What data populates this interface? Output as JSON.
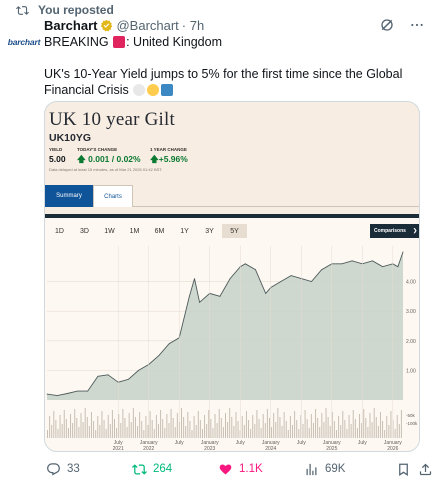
{
  "repost": {
    "label": "You reposted"
  },
  "author": {
    "avatar_text": "barchart",
    "name": "Barchart",
    "handle": "@Barchart",
    "time": "· 7h"
  },
  "tweet": {
    "breaking_prefix": "BREAKING",
    "breaking_country": ": United Kingdom",
    "body": "UK's 10-Year Yield jumps to 5% for the first time since the Global Financial Crisis"
  },
  "card": {
    "title": "UK 10 year Gilt",
    "symbol": "UK10YG",
    "yield_label": "YIELD",
    "yield_value": "5.00",
    "todays_change_label": "TODAY'S CHANGE",
    "todays_change_value": "0.001 / 0.02%",
    "year_change_label": "1 YEAR CHANGE",
    "year_change_value": "+5.96%",
    "note": "Data delayed at least 15 minutes, as of Mar 21 2026 01:42 BST.",
    "tabs": [
      "Summary",
      "Charts"
    ],
    "ranges": [
      "1D",
      "3D",
      "1W",
      "1M",
      "6M",
      "1Y",
      "3Y",
      "5Y"
    ],
    "active_range": "5Y",
    "comparisons_label": "Comparisons"
  },
  "chart_data": {
    "type": "area",
    "x": [
      "2020-05",
      "2020-07",
      "2020-09",
      "2020-11",
      "2021-01",
      "2021-03",
      "2021-05",
      "2021-07",
      "2021-09",
      "2021-11",
      "2022-01",
      "2022-03",
      "2022-05",
      "2022-07",
      "2022-09",
      "2022-10",
      "2022-11",
      "2023-01",
      "2023-03",
      "2023-05",
      "2023-07",
      "2023-08",
      "2023-10",
      "2023-12",
      "2024-01",
      "2024-03",
      "2024-05",
      "2024-07",
      "2024-09",
      "2024-11",
      "2025-01",
      "2025-03",
      "2025-05",
      "2025-07",
      "2025-09",
      "2025-11",
      "2026-01",
      "2026-02",
      "2026-03"
    ],
    "values": [
      0.2,
      0.15,
      0.22,
      0.3,
      0.3,
      0.8,
      0.85,
      0.6,
      0.7,
      1.0,
      1.2,
      1.5,
      1.9,
      2.1,
      3.5,
      4.1,
      3.3,
      3.6,
      3.5,
      4.1,
      4.5,
      4.6,
      4.4,
      3.6,
      3.8,
      4.0,
      4.2,
      4.1,
      4.0,
      4.4,
      4.6,
      4.6,
      4.7,
      4.6,
      4.7,
      4.5,
      4.6,
      4.5,
      5.0
    ],
    "y_ticks": [
      "4.00",
      "3.00",
      "2.00",
      "1.00"
    ],
    "volume_ticks": [
      "-50k",
      "-100k"
    ],
    "x_tick_labels": [
      {
        "month": "July",
        "year": "2021"
      },
      {
        "month": "January",
        "year": "2022"
      },
      {
        "month": "July",
        "year": ""
      },
      {
        "month": "January",
        "year": "2023"
      },
      {
        "month": "July",
        "year": ""
      },
      {
        "month": "January",
        "year": "2024"
      },
      {
        "month": "July",
        "year": ""
      },
      {
        "month": "January",
        "year": "2025"
      },
      {
        "month": "July",
        "year": ""
      },
      {
        "month": "January",
        "year": "2026"
      }
    ],
    "colors": {
      "line": "#4d5a5b",
      "fill": "#c7d2c8",
      "volume": "#c8bfb3"
    }
  },
  "actions": {
    "replies": "33",
    "reposts": "264",
    "likes": "1.1K",
    "views": "69K"
  },
  "colors": {
    "repost_green": "#00ba7c",
    "like_pink": "#f91880",
    "muted": "#536471",
    "ft_blue": "#0f5499"
  }
}
